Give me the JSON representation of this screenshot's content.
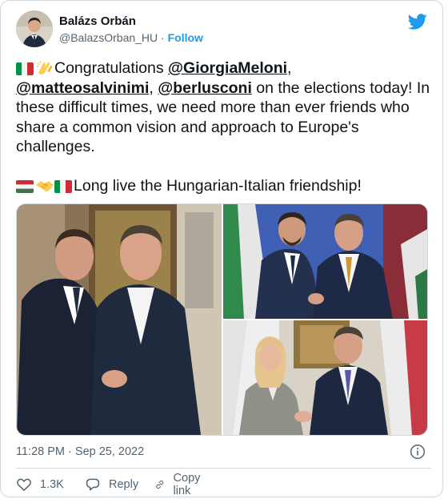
{
  "author": {
    "name": "Balázs Orbán",
    "handle": "@BalazsOrban_HU",
    "separator": "·",
    "follow_label": "Follow"
  },
  "tweet": {
    "line1_text": "Congratulations ",
    "mention1": "@GiorgiaMeloni",
    "comma1": ",",
    "mention2": "@matteosalvinimi",
    "comma2": ", ",
    "mention3": "@berlusconi",
    "line2_text": " on the elections today! In these difficult times, we need more than ever friends who share a common vision and approach to Europe's challenges.",
    "line3_text": "Long live the Hungarian-Italian friendship!"
  },
  "media": {
    "photos": [
      "berlusconi-orban-handshake",
      "salvini-orban-handshake",
      "meloni-orban-handshake"
    ]
  },
  "timestamp": {
    "time": "11:28 PM",
    "separator": "·",
    "date": "Sep 25, 2022"
  },
  "actions": {
    "like_count": "1.3K",
    "reply_label": "Reply",
    "copy_link_label": "Copy link"
  },
  "colors": {
    "accent": "#1d9bf0",
    "text": "#0f1419",
    "secondary": "#536471",
    "border": "#cfd9de"
  },
  "icons": [
    "twitter-bird-icon",
    "italy-flag-icon",
    "clapping-hands-icon",
    "hungary-flag-icon",
    "handshake-icon",
    "info-icon",
    "heart-icon",
    "reply-icon",
    "link-icon"
  ]
}
